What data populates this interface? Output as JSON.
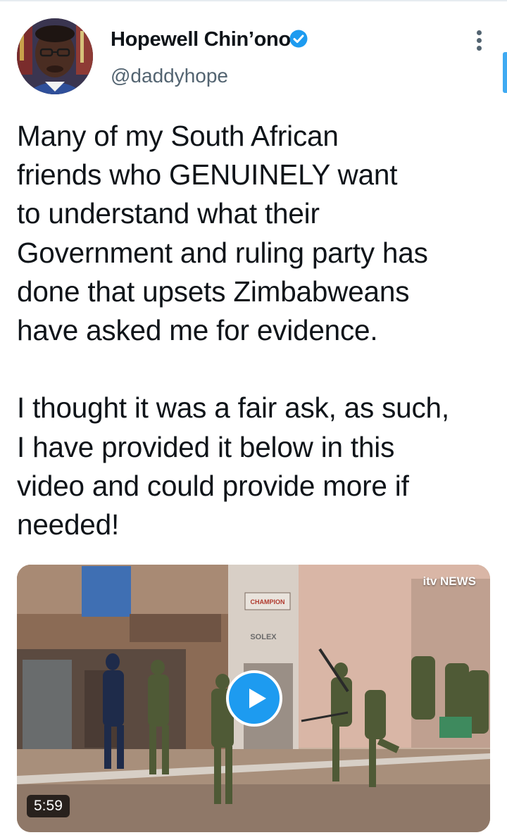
{
  "tweet": {
    "author": {
      "display_name": "Hopewell Chin’ono",
      "handle": "@daddyhope",
      "verified": true
    },
    "text": "Many of my South African\nfriends who GENUINELY want\nto understand what their\nGovernment and ruling party has\ndone that upsets Zimbabweans\nhave asked me for evidence.\n\nI thought it was a fair ask, as such,\nI have provided it below in this\nvideo and could provide more if\nneeded!",
    "media": {
      "type": "video",
      "duration": "5:59",
      "network_logo": "itv NEWS",
      "scene_text": {
        "sign_champion": "CHAMPION",
        "sign_solex": "SOLEX"
      }
    }
  },
  "icons": [
    "verified-badge-icon",
    "more-options-icon",
    "play-icon"
  ],
  "colors": {
    "accent": "#1d9bf0",
    "text_primary": "#0f1419",
    "text_secondary": "#536471",
    "background": "#ffffff"
  }
}
